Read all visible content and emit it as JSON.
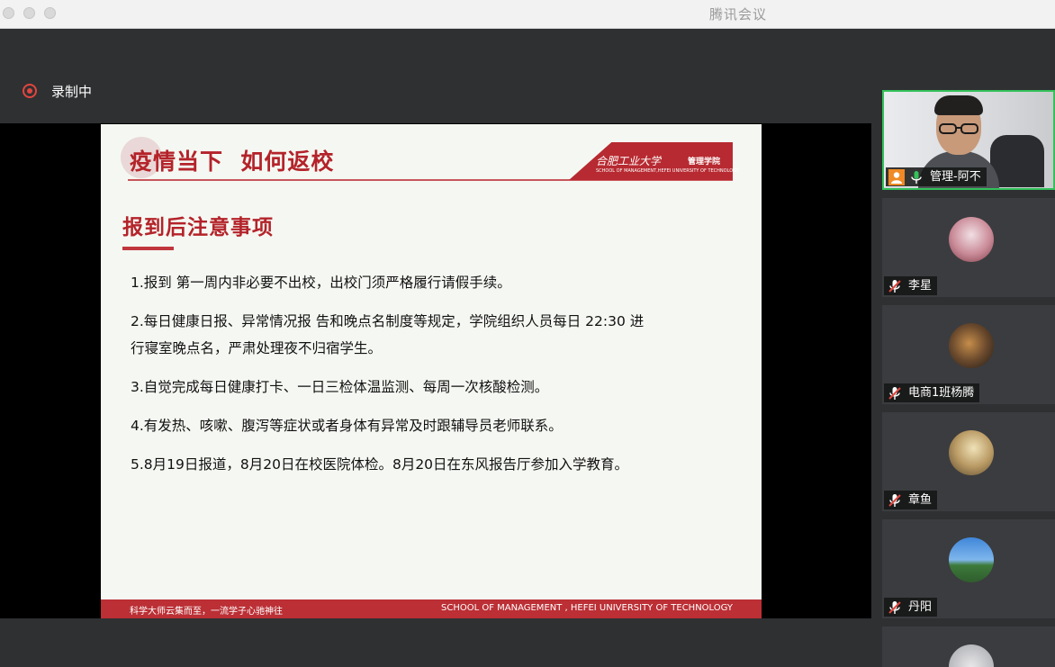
{
  "window": {
    "title": "腾讯会议"
  },
  "recording": {
    "label": "录制中"
  },
  "slide": {
    "header_title": "疫情当下  如何返校",
    "logo_cn": "合肥工业大学",
    "logo_school": "管理学院",
    "logo_en": "SCHOOL OF MANAGEMENT,HEFEI UNIVERSITY OF TECHNOLOGY",
    "section_title": "报到后注意事项",
    "items": [
      "1.报到 第一周内非必要不出校，出校门须严格履行请假手续。",
      "2.每日健康日报、异常情况报 告和晚点名制度等规定，学院组织人员每日 22:30 进",
      "行寝室晚点名，严肃处理夜不归宿学生。",
      "3.自觉完成每日健康打卡、一日三检体温监测、每周一次核酸检测。",
      "4.有发热、咳嗽、腹泻等症状或者身体有异常及时跟辅导员老师联系。",
      "5.8月19日报道，8月20日在校医院体检。8月20日在东风报告厅参加入学教育。"
    ],
    "footer_left": "科学大师云集而至，一流学子心驰神往",
    "footer_right": "SCHOOL OF MANAGEMENT , HEFEI UNIVERSITY OF TECHNOLOGY"
  },
  "participants": [
    {
      "name": "管理-阿不",
      "mic": "on",
      "host": true,
      "video": true
    },
    {
      "name": "李星",
      "mic": "muted"
    },
    {
      "name": "电商1班杨腾",
      "mic": "muted"
    },
    {
      "name": "章鱼",
      "mic": "muted"
    },
    {
      "name": "丹阳",
      "mic": "muted"
    }
  ],
  "colors": {
    "accent_red": "#b4232a",
    "active_speaker_border": "#33c15a",
    "host_badge": "#f08a24"
  }
}
